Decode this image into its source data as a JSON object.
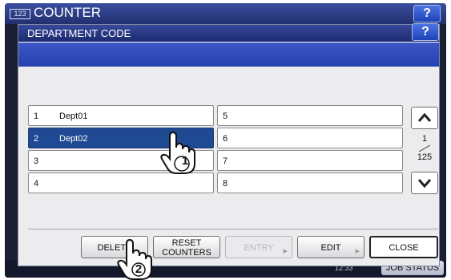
{
  "header": {
    "icon_text": "123",
    "title": "COUNTER",
    "help_label": "?"
  },
  "dialog": {
    "title": "DEPARTMENT CODE",
    "help_label": "?",
    "rows_left": [
      {
        "num": "1",
        "name": "Dept01",
        "selected": false
      },
      {
        "num": "2",
        "name": "Dept02",
        "selected": true
      },
      {
        "num": "3",
        "name": "",
        "selected": false
      },
      {
        "num": "4",
        "name": "",
        "selected": false
      }
    ],
    "rows_right": [
      {
        "num": "5",
        "name": ""
      },
      {
        "num": "6",
        "name": ""
      },
      {
        "num": "7",
        "name": ""
      },
      {
        "num": "8",
        "name": ""
      }
    ],
    "pager": {
      "current": "1",
      "total": "125"
    },
    "buttons": {
      "delete": "DELETE",
      "reset_line1": "RESET",
      "reset_line2": "COUNTERS",
      "entry": "ENTRY",
      "edit": "EDIT",
      "close": "CLOSE"
    }
  },
  "status_bar": {
    "time": "12:33",
    "job_status": "JOB STATUS"
  },
  "callouts": {
    "step1": "1",
    "step2": "2"
  },
  "colors": {
    "selected_row": "#1f4a93",
    "title_bar": "#2a3a87",
    "band": "#2e49b5"
  }
}
